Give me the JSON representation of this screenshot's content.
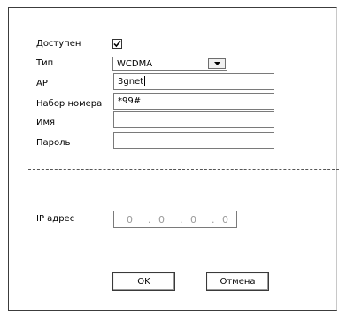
{
  "form": {
    "enabled_label": "Доступен",
    "enabled_checked": true,
    "type_label": "Тип",
    "type_value": "WCDMA",
    "ap_label": "AP",
    "ap_value": "3gnet",
    "dial_label": "Набор номера",
    "dial_value": "*99#",
    "name_label": "Имя",
    "name_value": "",
    "password_label": "Пароль",
    "password_value": ""
  },
  "network": {
    "ip_label": "IP адрес",
    "ip_octets": [
      "0",
      "0",
      "0",
      "0"
    ]
  },
  "buttons": {
    "ok_label": "OK",
    "cancel_label": "Отмена"
  },
  "icons": {
    "checkbox": "checkmark-icon",
    "dropdown": "triangle-down-icon"
  },
  "colors": {
    "border_dark": "#3c3c3c",
    "ip_text": "#9a9a9a"
  }
}
